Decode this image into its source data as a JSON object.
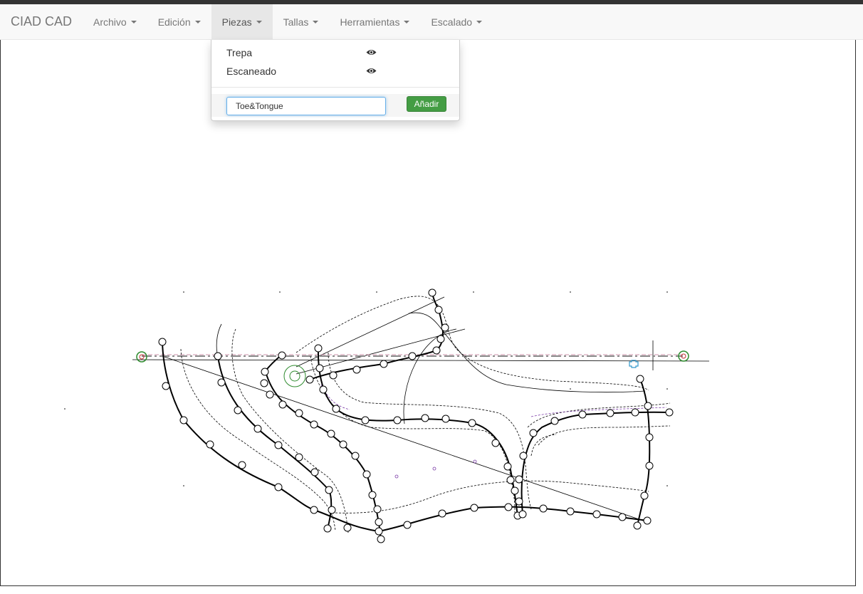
{
  "app": {
    "brand": "CIAD CAD"
  },
  "menu": [
    {
      "label": "Archivo"
    },
    {
      "label": "Edición"
    },
    {
      "label": "Piezas",
      "open": true
    },
    {
      "label": "Tallas"
    },
    {
      "label": "Herramientas"
    },
    {
      "label": "Escalado"
    }
  ],
  "piezas_dropdown": {
    "items": [
      {
        "label": "Trepa",
        "icon": "eye-icon",
        "visible": true
      },
      {
        "label": "Escaneado",
        "icon": "eye-icon",
        "visible": true
      }
    ],
    "new_piece_value": "Toe&Tongue",
    "add_button": "Añadir"
  },
  "colors": {
    "navbar_bg": "#f8f8f8",
    "open_menu_bg": "#e7e7e7",
    "add_button": "#449d44",
    "focus_border": "#66afe9",
    "pattern_line": "#000000",
    "marker_green": "#2e8b2e",
    "marker_blue": "#3399cc"
  }
}
